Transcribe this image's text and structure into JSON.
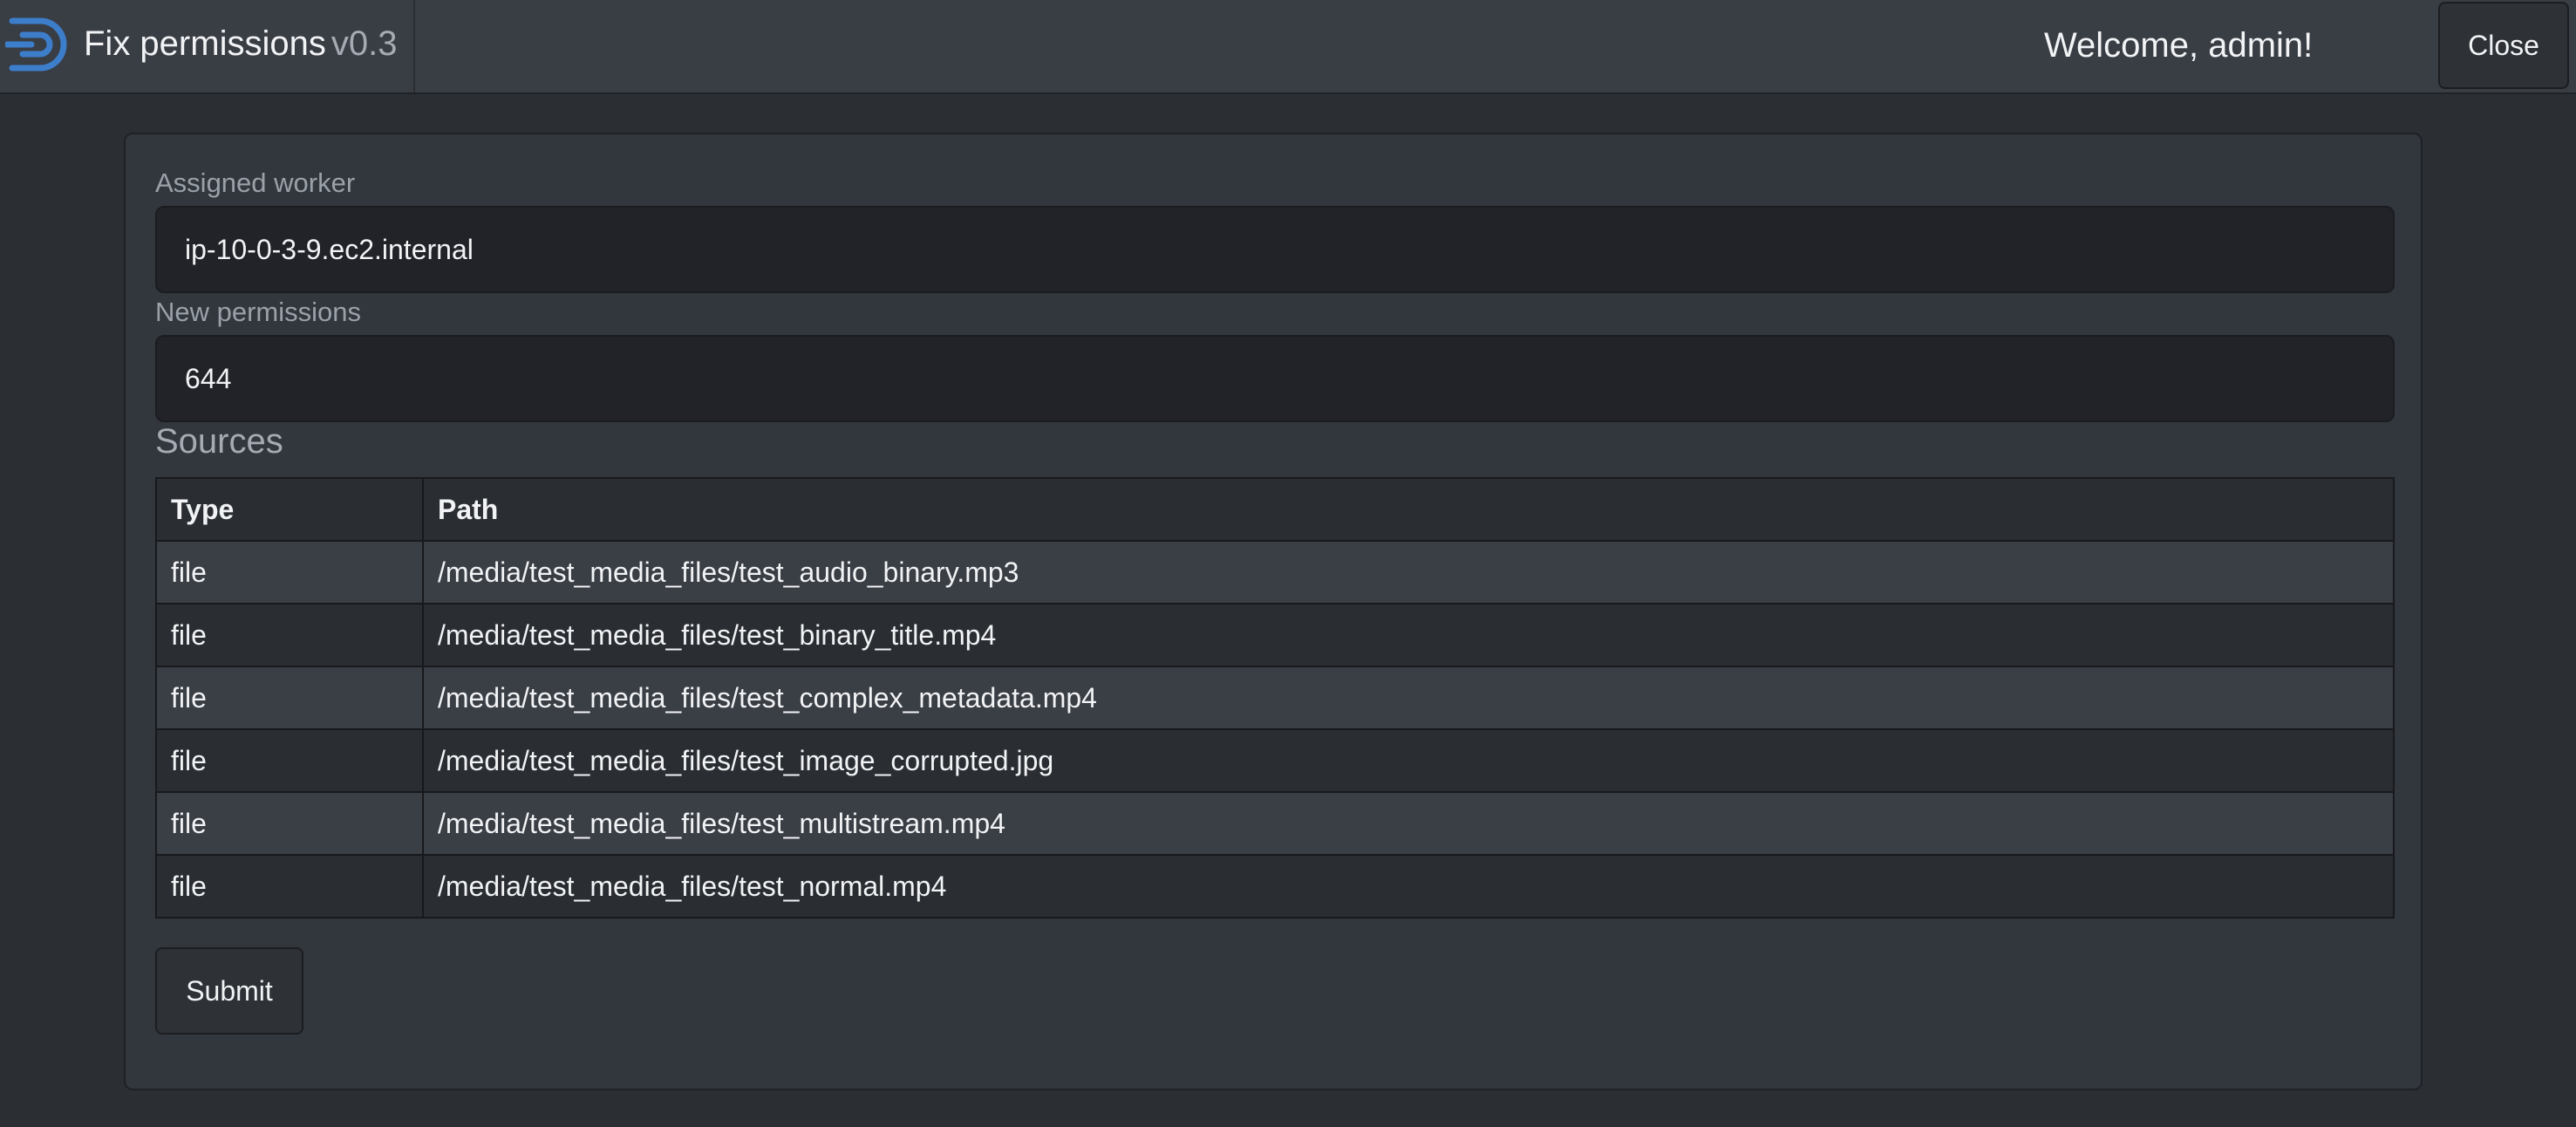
{
  "header": {
    "app_title": "Fix permissions",
    "version": "v0.3",
    "logo_icon": "app-logo-icon",
    "welcome_text": "Welcome, admin!",
    "close_label": "Close"
  },
  "form": {
    "assigned_worker_label": "Assigned worker",
    "assigned_worker_value": "ip-10-0-3-9.ec2.internal",
    "new_permissions_label": "New permissions",
    "new_permissions_value": "644",
    "sources_title": "Sources",
    "submit_label": "Submit"
  },
  "sources": {
    "columns": [
      "Type",
      "Path"
    ],
    "rows": [
      {
        "type": "file",
        "path": "/media/test_media_files/test_audio_binary.mp3"
      },
      {
        "type": "file",
        "path": "/media/test_media_files/test_binary_title.mp4"
      },
      {
        "type": "file",
        "path": "/media/test_media_files/test_complex_metadata.mp4"
      },
      {
        "type": "file",
        "path": "/media/test_media_files/test_image_corrupted.jpg"
      },
      {
        "type": "file",
        "path": "/media/test_media_files/test_multistream.mp4"
      },
      {
        "type": "file",
        "path": "/media/test_media_files/test_normal.mp4"
      }
    ]
  },
  "colors": {
    "navbar_bg": "#393d44",
    "page_bg": "#2b2e33",
    "logo_accent": "#3d7ecb"
  }
}
